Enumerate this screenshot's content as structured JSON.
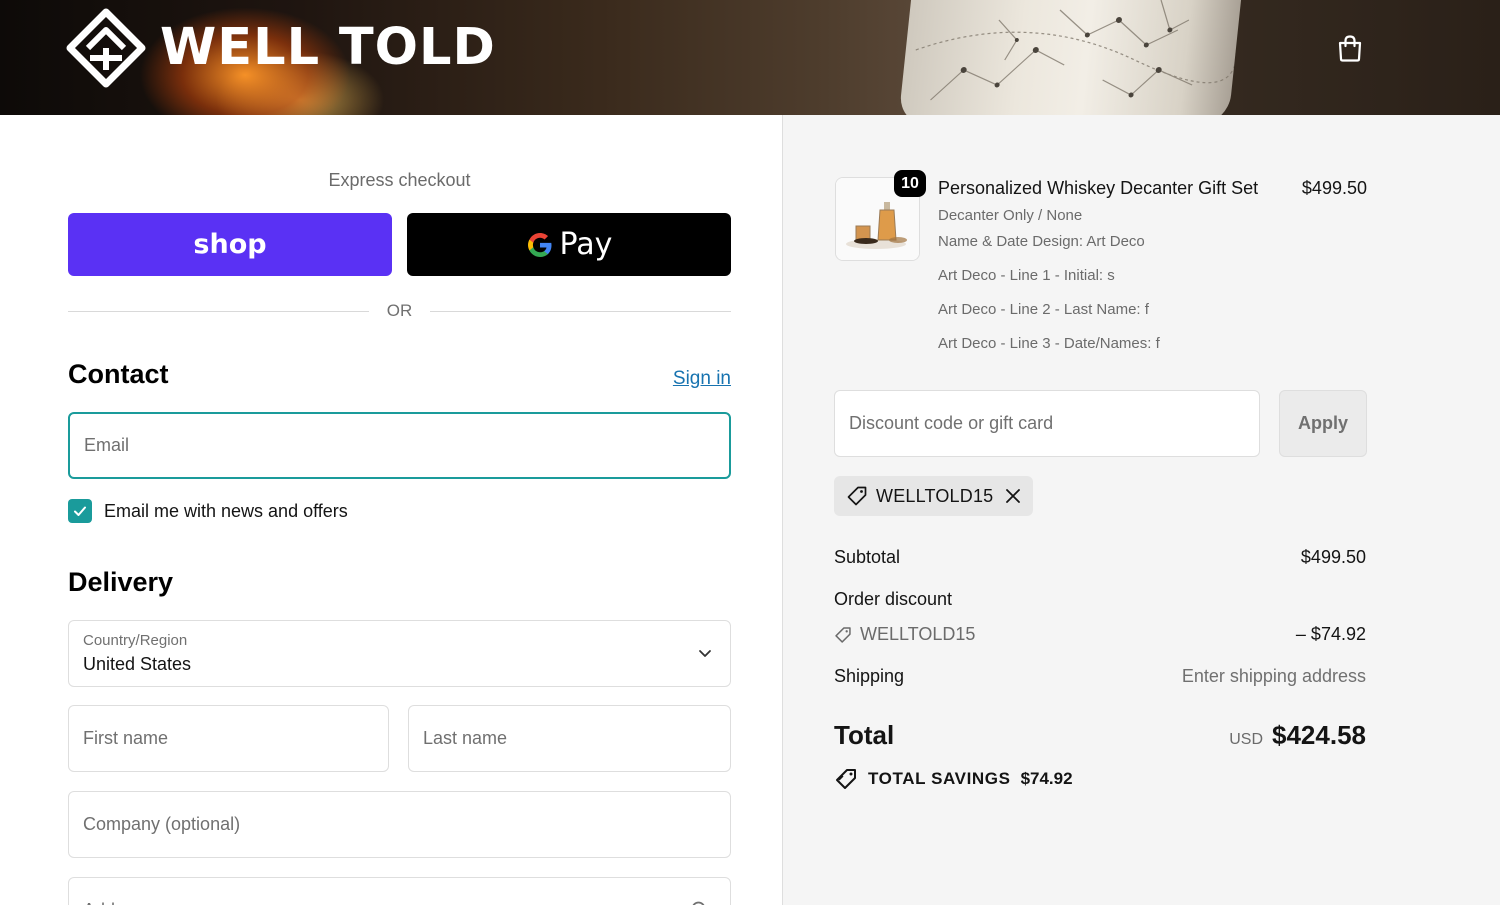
{
  "header": {
    "brand": "WELL TOLD",
    "cart_icon": "shopping-bag-icon"
  },
  "express": {
    "title": "Express checkout",
    "shop_label": "shop",
    "gpay_label": "Pay",
    "or_label": "OR"
  },
  "contact": {
    "title": "Contact",
    "sign_in": "Sign in",
    "email_placeholder": "Email",
    "news_label": "Email me with news and offers",
    "news_checked": true
  },
  "delivery": {
    "title": "Delivery",
    "country_caption": "Country/Region",
    "country_value": "United States",
    "first_name_placeholder": "First name",
    "last_name_placeholder": "Last name",
    "company_placeholder": "Company (optional)",
    "address_placeholder": "Address"
  },
  "order": {
    "quantity": "10",
    "product_name": "Personalized Whiskey Decanter Gift Set",
    "product_price": "$499.50",
    "options": [
      "Decanter Only / None",
      "Name & Date Design: Art Deco",
      "Art Deco - Line 1 - Initial: s",
      "Art Deco - Line 2 - Last Name: f",
      "Art Deco - Line 3 - Date/Names: f"
    ],
    "discount_placeholder": "Discount code or gift card",
    "apply_label": "Apply",
    "applied_code": "WELLTOLD15",
    "subtotal_label": "Subtotal",
    "subtotal_value": "$499.50",
    "order_discount_label": "Order discount",
    "discount_code": "WELLTOLD15",
    "discount_value": "– $74.92",
    "shipping_label": "Shipping",
    "shipping_value": "Enter shipping address",
    "total_label": "Total",
    "total_currency": "USD",
    "total_value": "$424.58",
    "savings_label": "TOTAL SAVINGS",
    "savings_value": "$74.92"
  },
  "colors": {
    "accent": "#1a9b9b",
    "shop_purple": "#5a31f4",
    "link": "#1773b0"
  }
}
